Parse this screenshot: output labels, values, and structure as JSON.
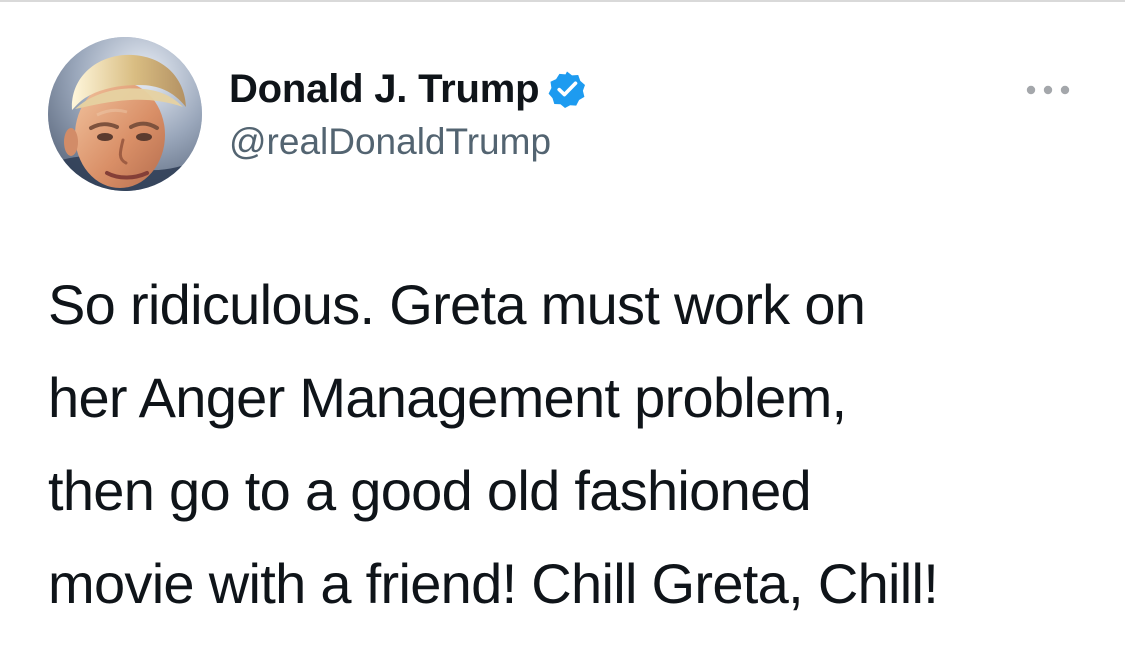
{
  "author": {
    "display_name": "Donald J. Trump",
    "handle": "@realDonaldTrump",
    "verified": true,
    "avatar": "profile-photo"
  },
  "actions": {
    "more_icon": "ellipsis-icon"
  },
  "tweet": {
    "lines": [
      "So ridiculous. Greta must work on",
      "her Anger Management problem,",
      "then go to a good old fashioned",
      "movie with a friend! Chill Greta, Chill!"
    ]
  },
  "colors": {
    "text_primary": "#0f1419",
    "text_secondary": "#536471",
    "verified_blue": "#1d9bf0",
    "divider": "#d9d9d9",
    "background": "#ffffff"
  }
}
